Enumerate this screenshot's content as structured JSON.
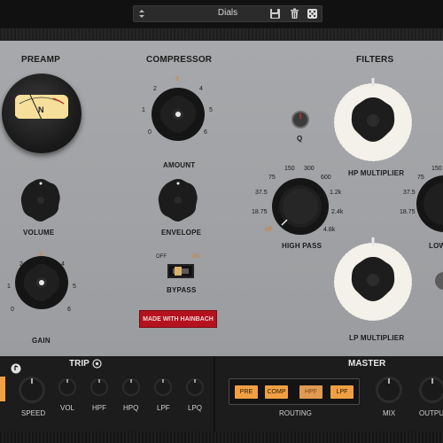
{
  "preset": {
    "name": "Dials"
  },
  "preamp": {
    "title": "PREAMP",
    "vu_letter": "N",
    "volume_label": "VOLUME",
    "gain_label": "GAIN",
    "gain_scale": [
      "0",
      "1",
      "2",
      "3",
      "4",
      "5",
      "6"
    ]
  },
  "compressor": {
    "title": "COMPRESSOR",
    "amount_label": "AMOUNT",
    "amount_scale": [
      "0",
      "1",
      "2",
      "3",
      "4",
      "5",
      "6"
    ],
    "envelope_label": "ENVELOPE",
    "bypass_label": "BYPASS",
    "off_label": "OFF",
    "on_label": "ON"
  },
  "badge": {
    "text": "MADE WITH HAINBACH"
  },
  "filters": {
    "title": "FILTERS",
    "q_label": "Q",
    "hp_mult_label": "HP MULTIPLIER",
    "lp_mult_label": "LP MULTIPLIER",
    "high_pass_label": "HIGH PASS",
    "low_pass_label_partial": "LOW",
    "hp_scale": [
      "off",
      "18.75",
      "37.5",
      "75",
      "150",
      "300",
      "600",
      "1.2k",
      "2.4k",
      "4.8k"
    ],
    "lp_scale_partial": [
      "37.5",
      "18.75",
      "75",
      "150"
    ]
  },
  "trip": {
    "title": "TRIP",
    "knobs": [
      "SPEED",
      "VOL",
      "HPF",
      "HPQ",
      "LPF",
      "LPQ"
    ]
  },
  "master": {
    "title": "MASTER",
    "routing_label": "ROUTING",
    "routing_buttons": [
      "PRE",
      "COMP",
      "HPF",
      "LPF"
    ],
    "mix_label": "MIX",
    "output_label": "OUTPUT"
  },
  "colors": {
    "accent": "#f0a043",
    "badge": "#b3121e",
    "panel": "#a3a5a8"
  }
}
